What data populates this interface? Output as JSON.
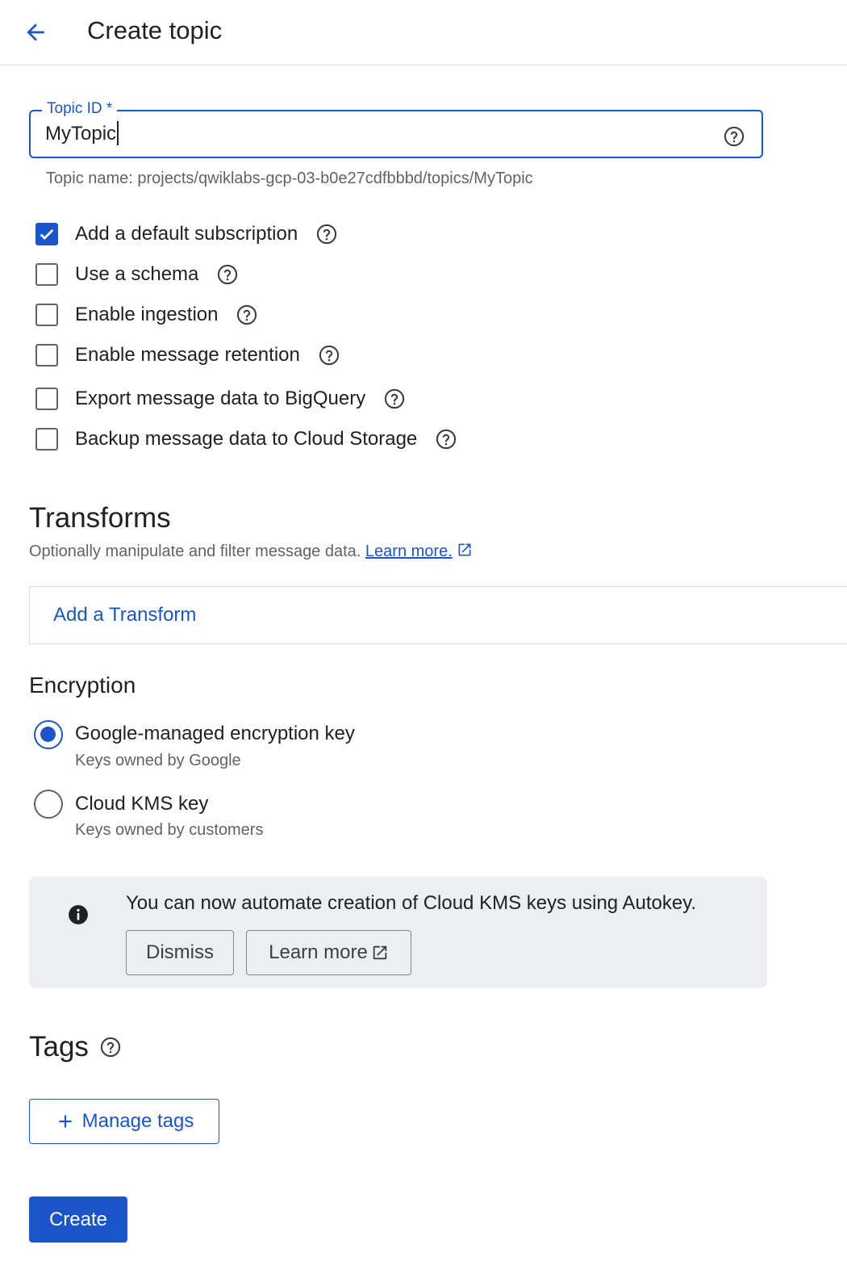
{
  "header": {
    "title": "Create topic",
    "back_icon": "arrow-back-icon"
  },
  "topic_field": {
    "label": "Topic ID *",
    "value": "MyTopic",
    "help_icon": "help-circle-icon",
    "helper_text": "Topic name: projects/qwiklabs-gcp-03-b0e27cdfbbbd/topics/MyTopic"
  },
  "options": [
    {
      "label": "Add a default subscription",
      "checked": true
    },
    {
      "label": "Use a schema",
      "checked": false
    },
    {
      "label": "Enable ingestion",
      "checked": false
    },
    {
      "label": "Enable message retention",
      "checked": false
    },
    {
      "label": "Export message data to BigQuery",
      "checked": false
    },
    {
      "label": "Backup message data to Cloud Storage",
      "checked": false
    }
  ],
  "transforms": {
    "title": "Transforms",
    "description": "Optionally manipulate and filter message data.",
    "learn_more": "Learn more.",
    "add_button": "Add a Transform"
  },
  "encryption": {
    "title": "Encryption",
    "options": [
      {
        "label": "Google-managed encryption key",
        "sublabel": "Keys owned by Google",
        "selected": true
      },
      {
        "label": "Cloud KMS key",
        "sublabel": "Keys owned by customers",
        "selected": false
      }
    ]
  },
  "banner": {
    "icon": "info-icon",
    "text": "You can now automate creation of Cloud KMS keys using Autokey.",
    "dismiss_label": "Dismiss",
    "learn_more_label": "Learn more"
  },
  "tags": {
    "title": "Tags",
    "manage_label": "Manage tags"
  },
  "create_label": "Create",
  "colors": {
    "accent": "#1a56c9",
    "banner_bg": "#eceef1",
    "text": "#202124",
    "secondary_text": "#5f6368"
  }
}
